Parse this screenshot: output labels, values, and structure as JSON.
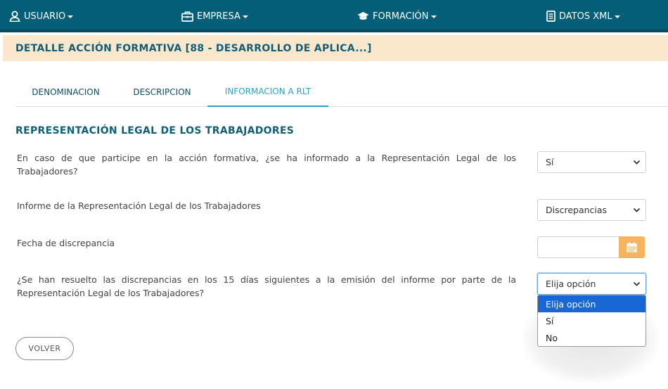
{
  "nav": {
    "items": [
      {
        "label": "USUARIO",
        "icon": "user-icon"
      },
      {
        "label": "EMPRESA",
        "icon": "briefcase-icon"
      },
      {
        "label": "FORMACIÓN",
        "icon": "graduation-cap-icon"
      },
      {
        "label": "DATOS XML",
        "icon": "document-icon"
      }
    ]
  },
  "page": {
    "title": "DETALLE ACCIÓN FORMATIVA [88 - DESARROLLO DE APLICA...]"
  },
  "tabs": [
    {
      "label": "DENOMINACION",
      "active": false
    },
    {
      "label": "DESCRIPCION",
      "active": false
    },
    {
      "label": "INFORMACION A RLT",
      "active": true
    }
  ],
  "section": {
    "title": "REPRESENTACIÓN LEGAL DE LOS TRABAJADORES"
  },
  "questions": [
    {
      "label": "En caso de que participe en la acción formativa, ¿se ha informado a la Representación Legal de los Trabajadores?",
      "value": "Sí"
    },
    {
      "label": "Informe de la Representación Legal de los Trabajadores",
      "value": "Discrepancias"
    },
    {
      "label": "Fecha de discrepancia",
      "value": ""
    },
    {
      "label": "¿Se han resuelto las discrepancias en los 15 días siguientes a la emisión del informe por parte de la Representación Legal de los Trabajadores?",
      "value": "Elija opción"
    }
  ],
  "dropdown": {
    "options": [
      "Elija opción",
      "Sí",
      "No"
    ],
    "selected": "Elija opción"
  },
  "buttons": {
    "back_label": "VOLVER"
  },
  "colors": {
    "nav_bg": "#045e78",
    "title_band": "#fbe7cc",
    "accent": "#2aa3c7",
    "calendar_btn": "#f7b460",
    "option_highlight": "#1967d2"
  }
}
